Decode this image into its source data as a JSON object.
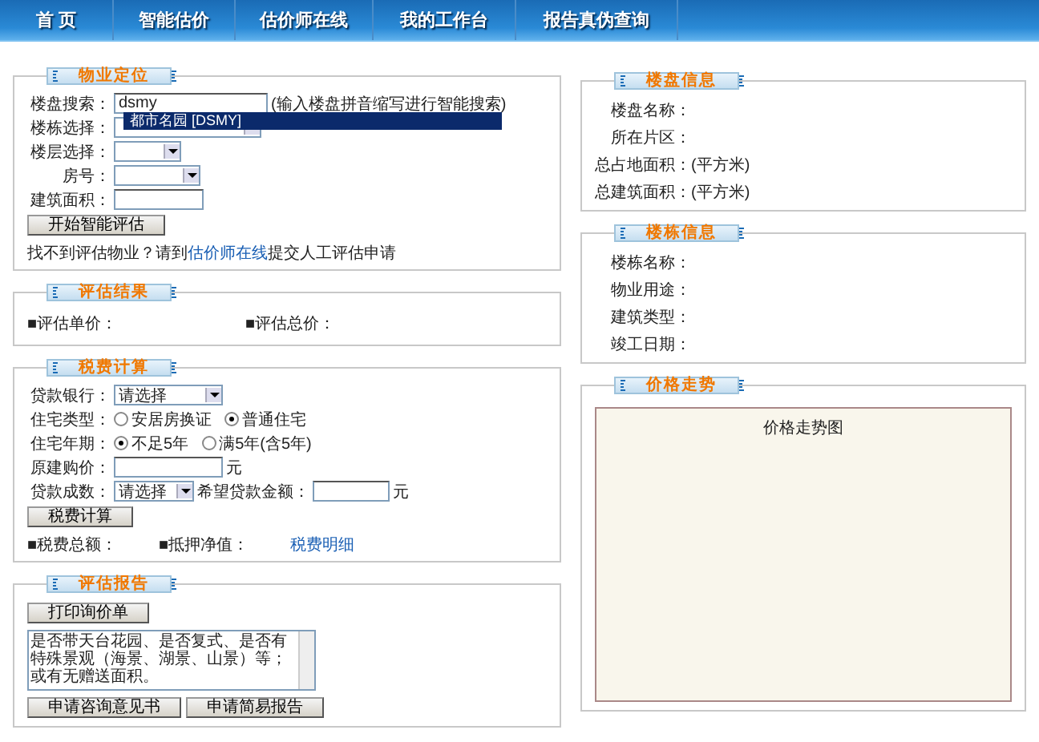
{
  "nav": [
    {
      "label": "首 页"
    },
    {
      "label": "智能估价"
    },
    {
      "label": "估价师在线"
    },
    {
      "label": "我的工作台"
    },
    {
      "label": "报告真伪查询"
    }
  ],
  "location": {
    "title": "物业定位",
    "search_label": "楼盘搜索：",
    "search_value": "dsmy",
    "search_hint": "(输入楼盘拼音缩写进行智能搜索)",
    "suggestion": "都市名园 [DSMY]",
    "building_label": "楼栋选择：",
    "floor_label": "楼层选择：",
    "room_label": "房号：",
    "area_label": "建筑面积：",
    "button": "开始智能评估",
    "note_before": "找不到评估物业？请到",
    "note_link": "估价师在线",
    "note_after": "提交人工评估申请"
  },
  "result": {
    "title": "评估结果",
    "items": [
      "■评估单价：",
      "■评估总价："
    ]
  },
  "tax": {
    "title": "税费计算",
    "bank_label": "贷款银行：",
    "bank_value": "请选择",
    "house_type_label": "住宅类型：",
    "house_types": [
      {
        "label": "安居房换证",
        "selected": false
      },
      {
        "label": "普通住宅",
        "selected": true
      }
    ],
    "years_label": "住宅年期：",
    "years": [
      {
        "label": "不足5年",
        "selected": true
      },
      {
        "label": "满5年(含5年)",
        "selected": false
      }
    ],
    "price_label": "原建购价：",
    "unit": "元",
    "ratio_label": "贷款成数：",
    "ratio_value": "请选择",
    "amount_label": "希望贷款金额：",
    "amount_unit": "元",
    "button": "税费计算",
    "totals": [
      "■税费总额：",
      "■抵押净值："
    ],
    "detail_link": "税费明细"
  },
  "report": {
    "title": "评估报告",
    "print_button": "打印询价单",
    "notes": "是否带天台花园、是否复式、是否有特殊景观（海景、湖景、山景）等；或有无赠送面积。",
    "buttons": [
      "申请咨询意见书",
      "申请简易报告"
    ]
  },
  "estate": {
    "title": "楼盘信息",
    "rows": [
      {
        "label": "楼盘名称："
      },
      {
        "label": "所在片区："
      },
      {
        "label": "总占地面积：",
        "unit": "(平方米)"
      },
      {
        "label": "总建筑面积：",
        "unit": "(平方米)"
      }
    ]
  },
  "building": {
    "title": "楼栋信息",
    "rows": [
      {
        "label": "楼栋名称："
      },
      {
        "label": "物业用途："
      },
      {
        "label": "建筑类型："
      },
      {
        "label": "竣工日期："
      }
    ]
  },
  "trend": {
    "title": "价格走势",
    "chart_title": "价格走势图"
  }
}
